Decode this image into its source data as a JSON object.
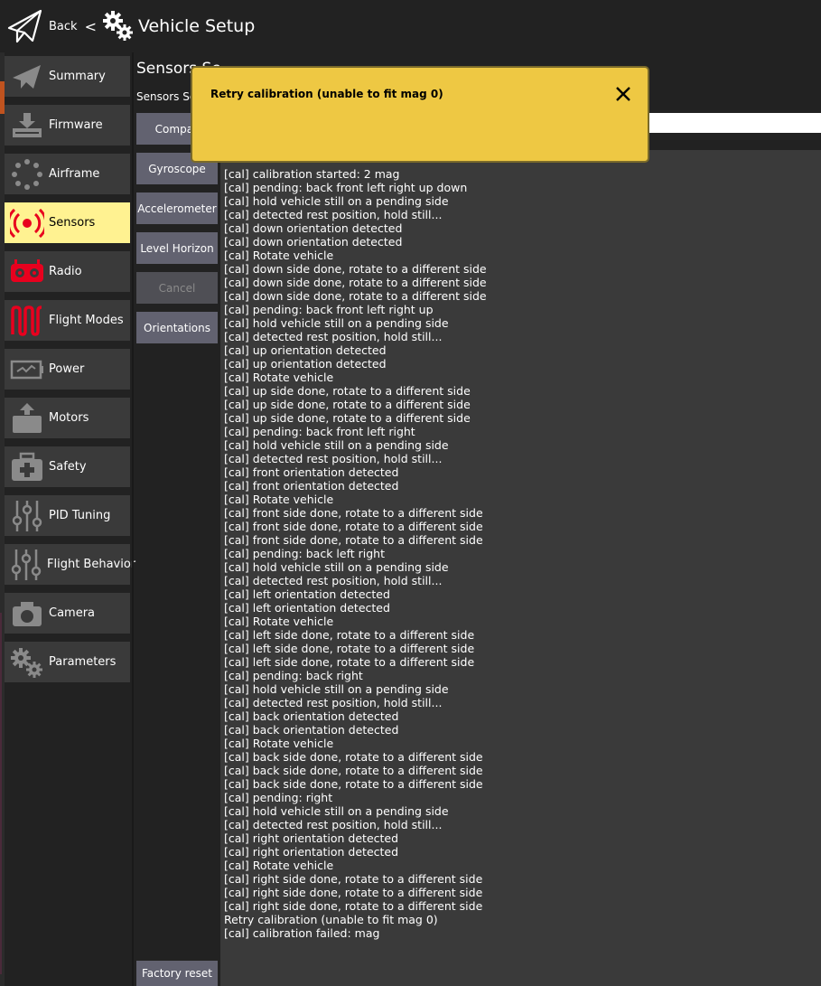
{
  "header": {
    "back_label": "Back",
    "separator": "<",
    "title": "Vehicle Setup"
  },
  "sidebar": {
    "items": [
      {
        "label": "Summary",
        "icon": "summary-icon"
      },
      {
        "label": "Firmware",
        "icon": "firmware-icon"
      },
      {
        "label": "Airframe",
        "icon": "airframe-icon"
      },
      {
        "label": "Sensors",
        "icon": "sensors-icon",
        "active": true
      },
      {
        "label": "Radio",
        "icon": "radio-icon"
      },
      {
        "label": "Flight Modes",
        "icon": "flight-modes-icon"
      },
      {
        "label": "Power",
        "icon": "power-icon"
      },
      {
        "label": "Motors",
        "icon": "motors-icon"
      },
      {
        "label": "Safety",
        "icon": "safety-icon"
      },
      {
        "label": "PID Tuning",
        "icon": "pid-tuning-icon"
      },
      {
        "label": "Flight Behavior",
        "icon": "flight-behavior-icon"
      },
      {
        "label": "Camera",
        "icon": "camera-icon"
      },
      {
        "label": "Parameters",
        "icon": "parameters-icon"
      }
    ]
  },
  "main": {
    "section_title": "Sensors Se",
    "section_subtitle": "Sensors Se",
    "buttons": [
      {
        "label": "Compas",
        "enabled": true
      },
      {
        "label": "Gyroscope",
        "enabled": true
      },
      {
        "label": "Accelerometer",
        "enabled": true
      },
      {
        "label": "Level Horizon",
        "enabled": true
      },
      {
        "label": "Cancel",
        "enabled": false
      },
      {
        "label": "Orientations",
        "enabled": true
      }
    ],
    "factory_reset_label": "Factory reset",
    "console_lines": [
      "[cal] calibration started: 2 mag",
      "[cal] pending: back front left right up down",
      "[cal] hold vehicle still on a pending side",
      "[cal] detected rest position, hold still...",
      "[cal] down orientation detected",
      "[cal] down orientation detected",
      "[cal] Rotate vehicle",
      "[cal] down side done, rotate to a different side",
      "[cal] down side done, rotate to a different side",
      "[cal] down side done, rotate to a different side",
      "[cal] pending: back front left right up",
      "[cal] hold vehicle still on a pending side",
      "[cal] detected rest position, hold still...",
      "[cal] up orientation detected",
      "[cal] up orientation detected",
      "[cal] Rotate vehicle",
      "[cal] up side done, rotate to a different side",
      "[cal] up side done, rotate to a different side",
      "[cal] up side done, rotate to a different side",
      "[cal] pending: back front left right",
      "[cal] hold vehicle still on a pending side",
      "[cal] detected rest position, hold still...",
      "[cal] front orientation detected",
      "[cal] front orientation detected",
      "[cal] Rotate vehicle",
      "[cal] front side done, rotate to a different side",
      "[cal] front side done, rotate to a different side",
      "[cal] front side done, rotate to a different side",
      "[cal] pending: back left right",
      "[cal] hold vehicle still on a pending side",
      "[cal] detected rest position, hold still...",
      "[cal] left orientation detected",
      "[cal] left orientation detected",
      "[cal] Rotate vehicle",
      "[cal] left side done, rotate to a different side",
      "[cal] left side done, rotate to a different side",
      "[cal] left side done, rotate to a different side",
      "[cal] pending: back right",
      "[cal] hold vehicle still on a pending side",
      "[cal] detected rest position, hold still...",
      "[cal] back orientation detected",
      "[cal] back orientation detected",
      "[cal] Rotate vehicle",
      "[cal] back side done, rotate to a different side",
      "[cal] back side done, rotate to a different side",
      "[cal] back side done, rotate to a different side",
      "[cal] pending: right",
      "[cal] hold vehicle still on a pending side",
      "[cal] detected rest position, hold still...",
      "[cal] right orientation detected",
      "[cal] right orientation detected",
      "[cal] Rotate vehicle",
      "[cal] right side done, rotate to a different side",
      "[cal] right side done, rotate to a different side",
      "[cal] right side done, rotate to a different side",
      "Retry calibration (unable to fit mag 0)",
      "[cal] calibration failed: mag"
    ]
  },
  "toast": {
    "message": "Retry calibration (unable to fit mag 0)",
    "close_icon": "close-icon",
    "background": "#eec843"
  },
  "colors": {
    "background": "#222222",
    "sidebar_item": "#3a3a3a",
    "active_item": "#fff291",
    "button": "#626270",
    "icon_red": "#e8001e"
  }
}
